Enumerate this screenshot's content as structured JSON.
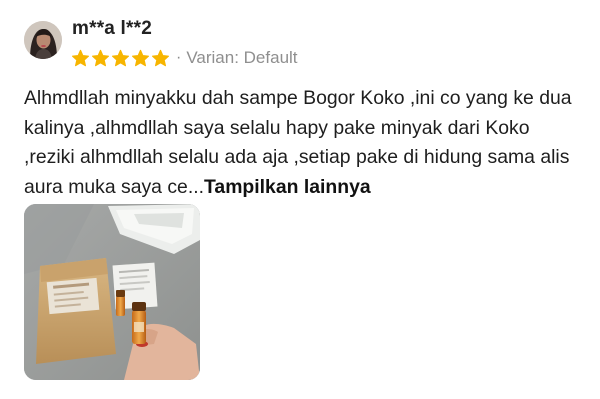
{
  "review": {
    "username": "m**a l**2",
    "rating": 5,
    "rating_max": 5,
    "star_color": "#F7B500",
    "separator": "·",
    "variant_label": "Varian: Default",
    "text": "Alhmdllah minyakku dah sampe Bogor Koko ,ini co yang ke dua kalinya ,alhmdllah saya selalu hapy pake minyak dari Koko ,reziki alhmdllah selalu ada aja ,setiap pake di hidung sama alis aura muka saya ce...",
    "show_more_label": "Tampilkan lainnya"
  },
  "icons": {
    "avatar": "user-avatar",
    "star": "star-icon",
    "photo": "review-photo"
  }
}
